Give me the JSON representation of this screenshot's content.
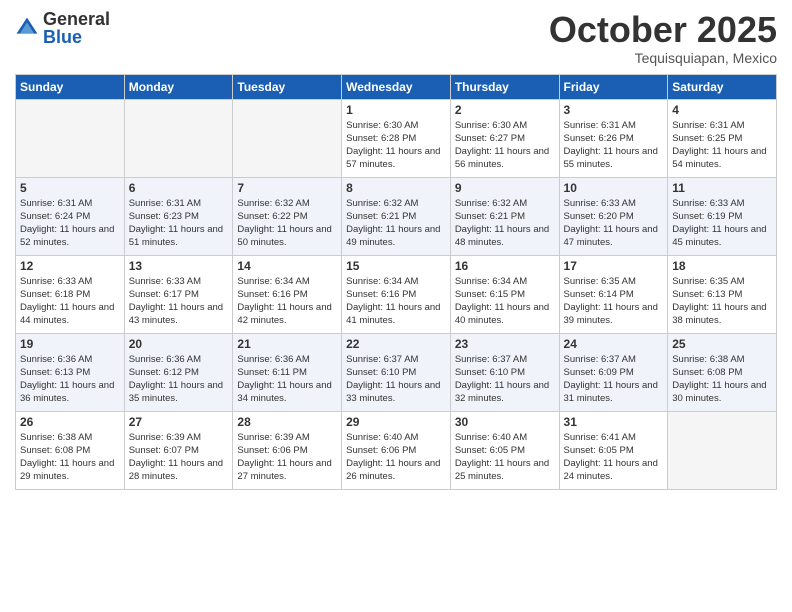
{
  "header": {
    "logo_general": "General",
    "logo_blue": "Blue",
    "title": "October 2025",
    "location": "Tequisquiapan, Mexico"
  },
  "weekdays": [
    "Sunday",
    "Monday",
    "Tuesday",
    "Wednesday",
    "Thursday",
    "Friday",
    "Saturday"
  ],
  "weeks": [
    [
      {
        "day": "",
        "sunrise": "",
        "sunset": "",
        "daylight": ""
      },
      {
        "day": "",
        "sunrise": "",
        "sunset": "",
        "daylight": ""
      },
      {
        "day": "",
        "sunrise": "",
        "sunset": "",
        "daylight": ""
      },
      {
        "day": "1",
        "sunrise": "Sunrise: 6:30 AM",
        "sunset": "Sunset: 6:28 PM",
        "daylight": "Daylight: 11 hours and 57 minutes."
      },
      {
        "day": "2",
        "sunrise": "Sunrise: 6:30 AM",
        "sunset": "Sunset: 6:27 PM",
        "daylight": "Daylight: 11 hours and 56 minutes."
      },
      {
        "day": "3",
        "sunrise": "Sunrise: 6:31 AM",
        "sunset": "Sunset: 6:26 PM",
        "daylight": "Daylight: 11 hours and 55 minutes."
      },
      {
        "day": "4",
        "sunrise": "Sunrise: 6:31 AM",
        "sunset": "Sunset: 6:25 PM",
        "daylight": "Daylight: 11 hours and 54 minutes."
      }
    ],
    [
      {
        "day": "5",
        "sunrise": "Sunrise: 6:31 AM",
        "sunset": "Sunset: 6:24 PM",
        "daylight": "Daylight: 11 hours and 52 minutes."
      },
      {
        "day": "6",
        "sunrise": "Sunrise: 6:31 AM",
        "sunset": "Sunset: 6:23 PM",
        "daylight": "Daylight: 11 hours and 51 minutes."
      },
      {
        "day": "7",
        "sunrise": "Sunrise: 6:32 AM",
        "sunset": "Sunset: 6:22 PM",
        "daylight": "Daylight: 11 hours and 50 minutes."
      },
      {
        "day": "8",
        "sunrise": "Sunrise: 6:32 AM",
        "sunset": "Sunset: 6:21 PM",
        "daylight": "Daylight: 11 hours and 49 minutes."
      },
      {
        "day": "9",
        "sunrise": "Sunrise: 6:32 AM",
        "sunset": "Sunset: 6:21 PM",
        "daylight": "Daylight: 11 hours and 48 minutes."
      },
      {
        "day": "10",
        "sunrise": "Sunrise: 6:33 AM",
        "sunset": "Sunset: 6:20 PM",
        "daylight": "Daylight: 11 hours and 47 minutes."
      },
      {
        "day": "11",
        "sunrise": "Sunrise: 6:33 AM",
        "sunset": "Sunset: 6:19 PM",
        "daylight": "Daylight: 11 hours and 45 minutes."
      }
    ],
    [
      {
        "day": "12",
        "sunrise": "Sunrise: 6:33 AM",
        "sunset": "Sunset: 6:18 PM",
        "daylight": "Daylight: 11 hours and 44 minutes."
      },
      {
        "day": "13",
        "sunrise": "Sunrise: 6:33 AM",
        "sunset": "Sunset: 6:17 PM",
        "daylight": "Daylight: 11 hours and 43 minutes."
      },
      {
        "day": "14",
        "sunrise": "Sunrise: 6:34 AM",
        "sunset": "Sunset: 6:16 PM",
        "daylight": "Daylight: 11 hours and 42 minutes."
      },
      {
        "day": "15",
        "sunrise": "Sunrise: 6:34 AM",
        "sunset": "Sunset: 6:16 PM",
        "daylight": "Daylight: 11 hours and 41 minutes."
      },
      {
        "day": "16",
        "sunrise": "Sunrise: 6:34 AM",
        "sunset": "Sunset: 6:15 PM",
        "daylight": "Daylight: 11 hours and 40 minutes."
      },
      {
        "day": "17",
        "sunrise": "Sunrise: 6:35 AM",
        "sunset": "Sunset: 6:14 PM",
        "daylight": "Daylight: 11 hours and 39 minutes."
      },
      {
        "day": "18",
        "sunrise": "Sunrise: 6:35 AM",
        "sunset": "Sunset: 6:13 PM",
        "daylight": "Daylight: 11 hours and 38 minutes."
      }
    ],
    [
      {
        "day": "19",
        "sunrise": "Sunrise: 6:36 AM",
        "sunset": "Sunset: 6:13 PM",
        "daylight": "Daylight: 11 hours and 36 minutes."
      },
      {
        "day": "20",
        "sunrise": "Sunrise: 6:36 AM",
        "sunset": "Sunset: 6:12 PM",
        "daylight": "Daylight: 11 hours and 35 minutes."
      },
      {
        "day": "21",
        "sunrise": "Sunrise: 6:36 AM",
        "sunset": "Sunset: 6:11 PM",
        "daylight": "Daylight: 11 hours and 34 minutes."
      },
      {
        "day": "22",
        "sunrise": "Sunrise: 6:37 AM",
        "sunset": "Sunset: 6:10 PM",
        "daylight": "Daylight: 11 hours and 33 minutes."
      },
      {
        "day": "23",
        "sunrise": "Sunrise: 6:37 AM",
        "sunset": "Sunset: 6:10 PM",
        "daylight": "Daylight: 11 hours and 32 minutes."
      },
      {
        "day": "24",
        "sunrise": "Sunrise: 6:37 AM",
        "sunset": "Sunset: 6:09 PM",
        "daylight": "Daylight: 11 hours and 31 minutes."
      },
      {
        "day": "25",
        "sunrise": "Sunrise: 6:38 AM",
        "sunset": "Sunset: 6:08 PM",
        "daylight": "Daylight: 11 hours and 30 minutes."
      }
    ],
    [
      {
        "day": "26",
        "sunrise": "Sunrise: 6:38 AM",
        "sunset": "Sunset: 6:08 PM",
        "daylight": "Daylight: 11 hours and 29 minutes."
      },
      {
        "day": "27",
        "sunrise": "Sunrise: 6:39 AM",
        "sunset": "Sunset: 6:07 PM",
        "daylight": "Daylight: 11 hours and 28 minutes."
      },
      {
        "day": "28",
        "sunrise": "Sunrise: 6:39 AM",
        "sunset": "Sunset: 6:06 PM",
        "daylight": "Daylight: 11 hours and 27 minutes."
      },
      {
        "day": "29",
        "sunrise": "Sunrise: 6:40 AM",
        "sunset": "Sunset: 6:06 PM",
        "daylight": "Daylight: 11 hours and 26 minutes."
      },
      {
        "day": "30",
        "sunrise": "Sunrise: 6:40 AM",
        "sunset": "Sunset: 6:05 PM",
        "daylight": "Daylight: 11 hours and 25 minutes."
      },
      {
        "day": "31",
        "sunrise": "Sunrise: 6:41 AM",
        "sunset": "Sunset: 6:05 PM",
        "daylight": "Daylight: 11 hours and 24 minutes."
      },
      {
        "day": "",
        "sunrise": "",
        "sunset": "",
        "daylight": ""
      }
    ]
  ]
}
